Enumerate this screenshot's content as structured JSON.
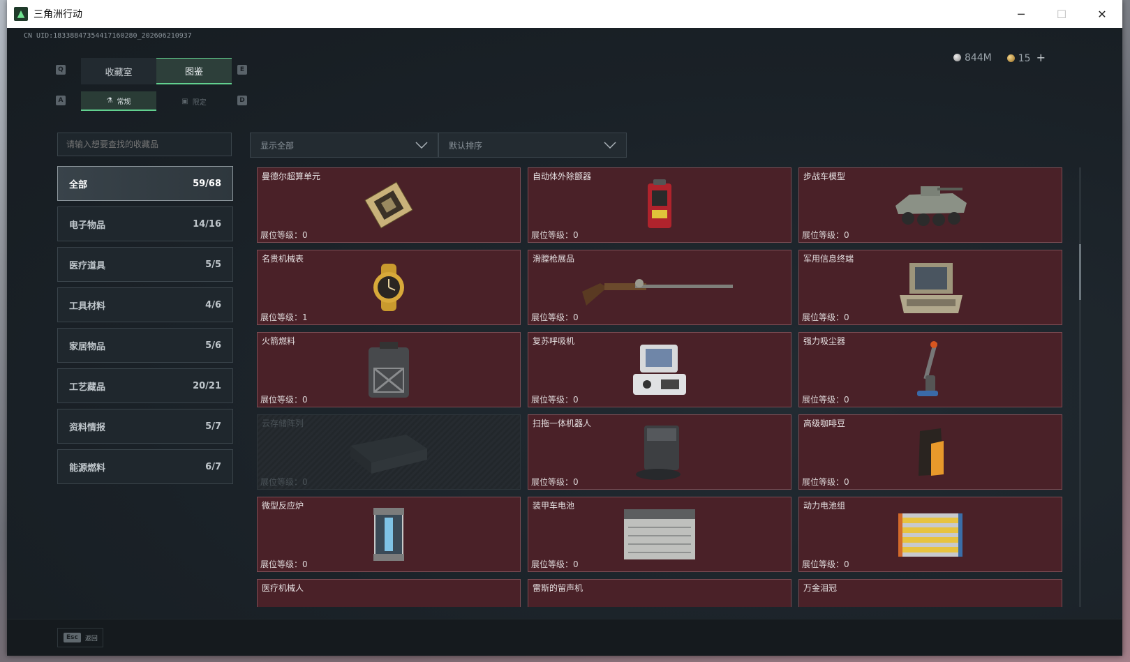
{
  "window": {
    "title": "三角洲行动",
    "uid": "CN UID:18338847354417160280_202606210937"
  },
  "currency": {
    "silver": "844M",
    "gold": "15"
  },
  "tabs": {
    "collection_room": "收藏室",
    "codex": "图鉴",
    "key_left": "Q",
    "key_right": "E"
  },
  "subtabs": {
    "normal": "常规",
    "limited": "限定",
    "key_left": "A",
    "key_right": "D"
  },
  "search": {
    "placeholder": "请输入想要查找的收藏品"
  },
  "filters": {
    "display": "显示全部",
    "sort": "默认排序"
  },
  "categories": [
    {
      "label": "全部",
      "count": "59/68"
    },
    {
      "label": "电子物品",
      "count": "14/16"
    },
    {
      "label": "医疗道具",
      "count": "5/5"
    },
    {
      "label": "工具材料",
      "count": "4/6"
    },
    {
      "label": "家居物品",
      "count": "5/6"
    },
    {
      "label": "工艺藏品",
      "count": "20/21"
    },
    {
      "label": "资料情报",
      "count": "5/7"
    },
    {
      "label": "能源燃料",
      "count": "6/7"
    }
  ],
  "items": [
    {
      "name": "曼德尔超算单元",
      "level": "展位等级：0"
    },
    {
      "name": "自动体外除颤器",
      "level": "展位等级：0"
    },
    {
      "name": "步战车模型",
      "level": "展位等级：0"
    },
    {
      "name": "名贵机械表",
      "level": "展位等级：1"
    },
    {
      "name": "滑膛枪展品",
      "level": "展位等级：0"
    },
    {
      "name": "军用信息终端",
      "level": "展位等级：0"
    },
    {
      "name": "火箭燃料",
      "level": "展位等级：0"
    },
    {
      "name": "复苏呼吸机",
      "level": "展位等级：0"
    },
    {
      "name": "强力吸尘器",
      "level": "展位等级：0"
    },
    {
      "name": "云存储阵列",
      "level": "展位等级：0"
    },
    {
      "name": "扫拖一体机器人",
      "level": "展位等级：0"
    },
    {
      "name": "高级咖啡豆",
      "level": "展位等级：0"
    },
    {
      "name": "微型反应炉",
      "level": "展位等级：0"
    },
    {
      "name": "装甲车电池",
      "level": "展位等级：0"
    },
    {
      "name": "动力电池组",
      "level": "展位等级：0"
    },
    {
      "name": "医疗机械人",
      "level": ""
    },
    {
      "name": "雷斯的留声机",
      "level": ""
    },
    {
      "name": "万金泪冠",
      "level": ""
    }
  ],
  "bottom": {
    "esc_key": "Esc",
    "back_label": "返回"
  }
}
